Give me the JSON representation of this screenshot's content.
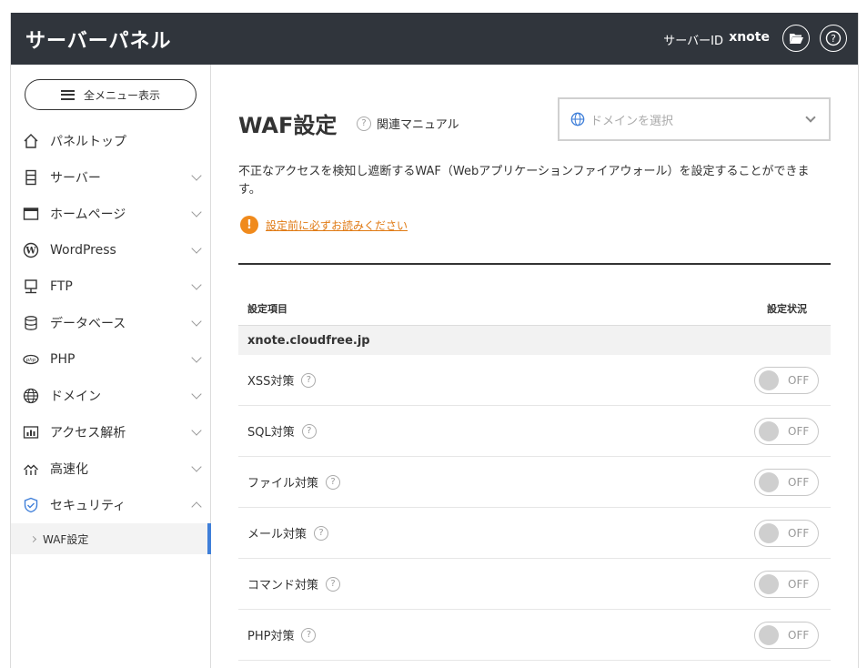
{
  "header": {
    "title": "サーバーパネル",
    "server_id_label": "サーバーID",
    "server_id_value": "xnote",
    "folder_icon": "folder-open-icon",
    "help_icon": "help-circle-icon"
  },
  "sidebar": {
    "all_menu_label": "全メニュー表示",
    "items": [
      {
        "label": "パネルトップ",
        "icon": "home-icon"
      },
      {
        "label": "サーバー",
        "icon": "server-icon"
      },
      {
        "label": "ホームページ",
        "icon": "browser-window-icon"
      },
      {
        "label": "WordPress",
        "icon": "wordpress-icon"
      },
      {
        "label": "FTP",
        "icon": "ftp-monitor-icon"
      },
      {
        "label": "データベース",
        "icon": "database-icon"
      },
      {
        "label": "PHP",
        "icon": "php-icon"
      },
      {
        "label": "ドメイン",
        "icon": "globe-icon"
      },
      {
        "label": "アクセス解析",
        "icon": "bar-chart-icon"
      },
      {
        "label": "高速化",
        "icon": "speed-icon"
      },
      {
        "label": "セキュリティ",
        "icon": "shield-icon"
      }
    ],
    "active_sub": "WAF設定"
  },
  "main": {
    "title": "WAF設定",
    "manual_label": "関連マニュアル",
    "domain_placeholder": "ドメインを選択",
    "description": "不正なアクセスを検知し遮断するWAF（Webアプリケーションファイアウォール）を設定することができます。",
    "warning_link": "設定前に必ずお読みください",
    "table": {
      "col_item": "設定項目",
      "col_status": "設定状況",
      "domain": "xnote.cloudfree.jp",
      "rows": [
        {
          "label": "XSS対策",
          "state": "OFF"
        },
        {
          "label": "SQL対策",
          "state": "OFF"
        },
        {
          "label": "ファイル対策",
          "state": "OFF"
        },
        {
          "label": "メール対策",
          "state": "OFF"
        },
        {
          "label": "コマンド対策",
          "state": "OFF"
        },
        {
          "label": "PHP対策",
          "state": "OFF"
        }
      ]
    }
  },
  "colors": {
    "header_bg": "#30353c",
    "accent_blue": "#3f7fd9",
    "warning_orange": "#f08a1c"
  }
}
